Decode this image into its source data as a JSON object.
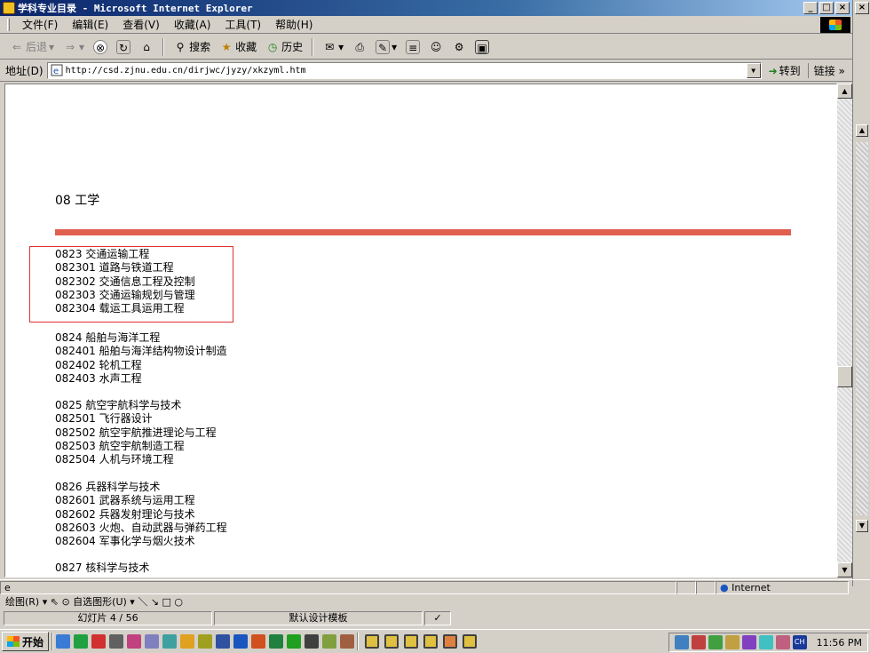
{
  "window": {
    "title": "学科专业目录 - Microsoft Internet Explorer",
    "controls": [
      "_",
      "□",
      "×"
    ]
  },
  "menu": [
    "文件(F)",
    "编辑(E)",
    "查看(V)",
    "收藏(A)",
    "工具(T)",
    "帮助(H)"
  ],
  "toolbar": {
    "back": "后退",
    "search": "搜索",
    "favorites": "收藏",
    "history": "历史"
  },
  "address": {
    "label": "地址(D)",
    "url": "http://csd.zjnu.edu.cn/dirjwc/jyzy/xkzyml.htm",
    "go": "转到",
    "links": "链接 »"
  },
  "content": {
    "heading": "08 工学",
    "groups": [
      {
        "lines": [
          "0823 交通运输工程",
          "082301 道路与铁道工程",
          "082302 交通信息工程及控制",
          "082303 交通运输规划与管理",
          "082304 载运工具运用工程"
        ]
      },
      {
        "lines": [
          "0824 船舶与海洋工程",
          "082401 船舶与海洋结构物设计制造",
          "082402 轮机工程",
          "082403 水声工程"
        ]
      },
      {
        "lines": [
          "0825 航空宇航科学与技术",
          "082501 飞行器设计",
          "082502 航空宇航推进理论与工程",
          "082503 航空宇航制造工程",
          "082504 人机与环境工程"
        ]
      },
      {
        "lines": [
          "0826 兵器科学与技术",
          "082601 武器系统与运用工程",
          "082602 兵器发射理论与技术",
          "082603 火炮、自动武器与弹药工程",
          "082604 军事化学与烟火技术"
        ]
      },
      {
        "lines": [
          "0827 核科学与技术"
        ]
      }
    ]
  },
  "status": {
    "zone": "Internet"
  },
  "ppt": {
    "draw_toolbar": "绘图(R) ▾  ⇖  ⊙  自选图形(U) ▾  ＼  ↘  □  ○",
    "slide": "幻灯片 4 / 56",
    "template": "默认设计模板"
  },
  "taskbar": {
    "start": "开始",
    "clock": "11:56 PM",
    "ime": "CH"
  }
}
